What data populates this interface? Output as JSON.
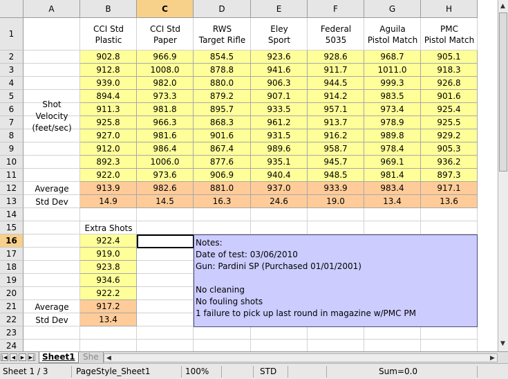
{
  "columns": [
    "A",
    "B",
    "C",
    "D",
    "E",
    "F",
    "G",
    "H"
  ],
  "selected_column": "C",
  "rows": [
    "1",
    "2",
    "3",
    "4",
    "5",
    "6",
    "7",
    "8",
    "9",
    "10",
    "11",
    "12",
    "13",
    "14",
    "15",
    "16",
    "17",
    "18",
    "19",
    "20",
    "21",
    "22",
    "23",
    "24"
  ],
  "selected_row": "16",
  "ammo_headers": [
    {
      "line1": "CCI Std",
      "line2": "Plastic"
    },
    {
      "line1": "CCI Std",
      "line2": "Paper"
    },
    {
      "line1": "RWS",
      "line2": "Target Rifle"
    },
    {
      "line1": "Eley",
      "line2": "Sport"
    },
    {
      "line1": "Federal",
      "line2": "5035"
    },
    {
      "line1": "Aguila",
      "line2": "Pistol Match"
    },
    {
      "line1": "PMC",
      "line2": "Pistol Match"
    }
  ],
  "velocity_label": {
    "line1": "Shot",
    "line2": "Velocity",
    "line3": "(feet/sec)"
  },
  "velocity_data": [
    [
      "902.8",
      "966.9",
      "854.5",
      "923.6",
      "928.6",
      "968.7",
      "905.1"
    ],
    [
      "912.8",
      "1008.0",
      "878.8",
      "941.6",
      "911.7",
      "1011.0",
      "918.3"
    ],
    [
      "939.0",
      "982.0",
      "880.0",
      "906.3",
      "944.5",
      "999.3",
      "926.8"
    ],
    [
      "894.4",
      "973.3",
      "879.2",
      "907.1",
      "914.2",
      "983.5",
      "901.6"
    ],
    [
      "911.3",
      "981.8",
      "895.7",
      "933.5",
      "957.1",
      "973.4",
      "925.4"
    ],
    [
      "925.8",
      "966.3",
      "868.3",
      "961.2",
      "913.7",
      "978.9",
      "925.5"
    ],
    [
      "927.0",
      "981.6",
      "901.6",
      "931.5",
      "916.2",
      "989.8",
      "929.2"
    ],
    [
      "912.0",
      "986.4",
      "867.4",
      "989.6",
      "958.7",
      "978.4",
      "905.3"
    ],
    [
      "892.3",
      "1006.0",
      "877.6",
      "935.1",
      "945.7",
      "969.1",
      "936.2"
    ],
    [
      "922.0",
      "973.6",
      "906.9",
      "940.4",
      "948.5",
      "981.4",
      "897.3"
    ]
  ],
  "average_label": "Average",
  "stddev_label": "Std Dev",
  "averages": [
    "913.9",
    "982.6",
    "881.0",
    "937.0",
    "933.9",
    "983.4",
    "917.1"
  ],
  "stddevs": [
    "14.9",
    "14.5",
    "16.3",
    "24.6",
    "19.0",
    "13.4",
    "13.6"
  ],
  "extra_shots_label": "Extra Shots",
  "extra_shots": [
    "922.4",
    "919.0",
    "923.8",
    "934.6",
    "922.2"
  ],
  "extra_average": "917.2",
  "extra_stddev": "13.4",
  "notes": [
    "Notes:",
    "Date of test: 03/06/2010",
    "Gun: Pardini SP (Purchased 01/01/2001)",
    "",
    "No cleaning",
    "No fouling shots",
    "1 failure to pick up last round in magazine w/PMC PM"
  ],
  "tabs": {
    "active": "Sheet1",
    "other": "She"
  },
  "status": {
    "sheet": "Sheet 1 / 3",
    "page_style": "PageStyle_Sheet1",
    "zoom": "100%",
    "mode": "STD",
    "sum": "Sum=0.0"
  },
  "colors": {
    "data_fill": "#ffff99",
    "summary_fill": "#ffcc99",
    "notes_fill": "#ccccff",
    "selected_header": "#f7d08a"
  }
}
